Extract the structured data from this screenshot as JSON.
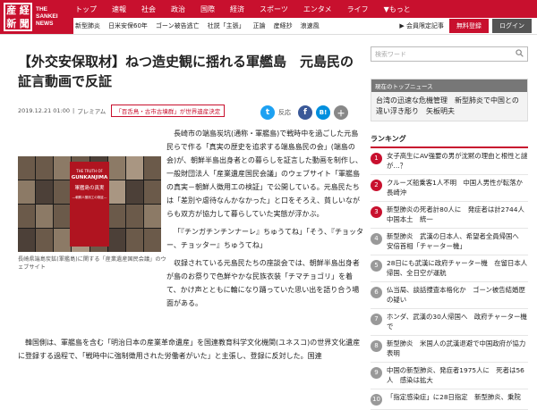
{
  "logo": {
    "kanji": [
      "産",
      "経",
      "新",
      "聞"
    ],
    "en_line1": "THE",
    "en_line2": "SANKEI",
    "en_line3": "NEWS"
  },
  "nav": {
    "items": [
      "トップ",
      "速報",
      "社会",
      "政治",
      "国際",
      "経済",
      "スポーツ",
      "エンタメ",
      "ライフ",
      "▼もっと"
    ]
  },
  "subnav": {
    "items": [
      "新型肺炎",
      "日米安保60年",
      "ゴーン被告逃亡",
      "社説「主張」",
      "正論",
      "産経抄",
      "浪速風"
    ]
  },
  "account": {
    "register": "▶ 会員限定記事",
    "free_register": "無料登録",
    "login": "ログイン"
  },
  "article": {
    "title": "【外交安保取材】ねつ造史観に揺れる軍艦島　元島民の証言動画で反証",
    "date": "2019.12.21 01:00",
    "premium": "プレミアム",
    "tag": "「百舌鳥・古市古墳群」が世界遺産決定",
    "figure_book_t1": "THE TRUTH OF",
    "figure_book_t2": "GUNKANJIMA",
    "figure_book_t3": "軍艦島の真実",
    "figure_book_t4": "―朝鮮人徴用工の検証―",
    "caption": "長崎県端島炭鉱(軍艦島)に関する「産業遺産国民会議」のウェブサイト",
    "para1": "長崎市の端島炭坑(通称・軍艦島)で戦時中を過ごした元島民らで作る「真実の歴史を追求する端島島民の会」(端島の会)が、朝鮮半島出身者との暮らしを証言した動画を制作し、一般財団法人「産業遺産国民会議」のウェブサイト「軍艦島の真実－朝鮮人徴用工の検証」で公開している。元島民たちは「差別や虐待なんかなかった」と口をそろえ、貧しいながらも双方が協力して暮らしていた実態が浮かぶ。",
    "para2": "「『チンガチンチンナーレ』ちゅうてね」「そう、『チョッター、チョッター』ちゅうてね」",
    "para3": "収録されている元島民たちの座談会では、朝鮮半島出身者が島のお祭りで色鮮やかな民族衣装「チマチョゴリ」を着て、かけ声とともに輪になり踊っていた思い出を語り合う場面がある。",
    "para4": "韓国側は、軍艦島を含む「明治日本の産業革命遺産」を国連教育科学文化機関(ユネスコ)の世界文化遺産に登録する過程で、「戦時中に強制徴用された労働者がいた」と主張し、登録に反対した。国連"
  },
  "share": {
    "twitter": "t",
    "count": "反応",
    "facebook": "f",
    "hatena": "B!",
    "more": "＋"
  },
  "sidebar": {
    "search_placeholder": "検索ワード",
    "top_news_header": "現在のトップニュース",
    "top_news_text": "台湾の迅速な危機管理　新型肺炎で中国との違い浮き彫り　矢板明夫",
    "ranking_title": "ランキング",
    "ranking": [
      {
        "n": "1",
        "text": "女子高生にAV強要の男が沈黙の理由と根性と謎が…？"
      },
      {
        "n": "2",
        "text": "クルーズ船乗客1人不明　中国人男性が転落か　長崎沖"
      },
      {
        "n": "3",
        "text": "新型肺炎の死者計80人に　発症者は計2744人　中国本土　統一"
      },
      {
        "n": "4",
        "text": "新型肺炎　武漢の日本人、希望者全員帰国へ　安倍首相「チャーター機」"
      },
      {
        "n": "5",
        "text": "28日にも武漢に政府チャーター機　在留日本人帰国、全日空が運航"
      },
      {
        "n": "6",
        "text": "仏当局、談話捜査本格化か　ゴーン被告結婚歴の疑い"
      },
      {
        "n": "7",
        "text": "ホンダ、武漢の30人帰国へ　政府チャーター機で"
      },
      {
        "n": "8",
        "text": "新型肺炎　米国人の武漢退避で中国政府が協力表明"
      },
      {
        "n": "9",
        "text": "中国の新型肺炎、発症者1975人に　死者は56人　感染は拡大"
      },
      {
        "n": "10",
        "text": "「指定感染症」に28日指定　新型肺炎、乗院"
      }
    ]
  }
}
